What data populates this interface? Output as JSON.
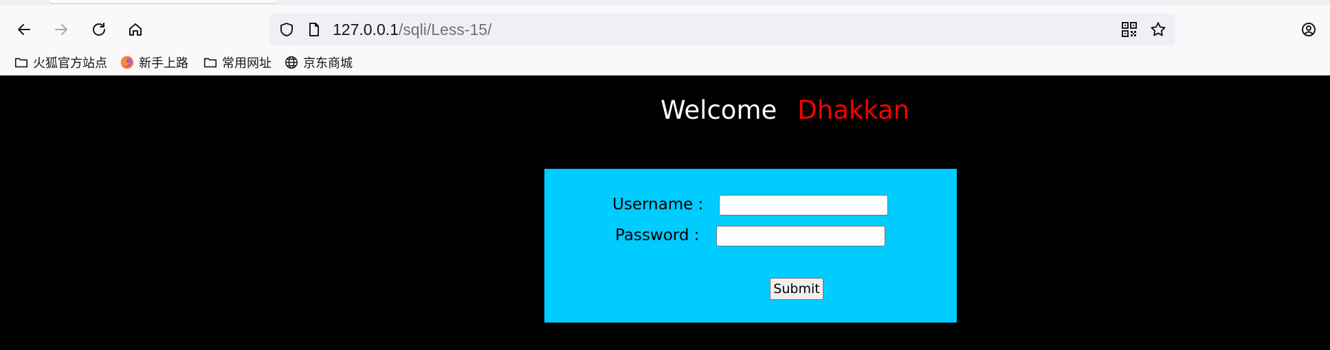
{
  "browser": {
    "url": {
      "host": "127.0.0.1",
      "path": "/sqli/Less-15/"
    },
    "nav_icons": [
      "back-icon",
      "forward-icon",
      "reload-icon",
      "home-icon",
      "account-icon"
    ],
    "urlbar_icons": [
      "shield-icon",
      "page-icon",
      "qr-code-icon",
      "star-icon"
    ],
    "bookmarks": [
      {
        "label": "火狐官方站点",
        "icon": "folder-icon"
      },
      {
        "label": "新手上路",
        "icon": "firefox-icon"
      },
      {
        "label": "常用网址",
        "icon": "folder-icon"
      },
      {
        "label": "京东商城",
        "icon": "globe-icon"
      }
    ]
  },
  "page": {
    "background": "#000000",
    "welcome": {
      "word": "Welcome",
      "name": "Dhakkan",
      "word_color": "#ffffff",
      "name_color": "#ff0000"
    },
    "form": {
      "panel_color": "#00ccff",
      "username_label": "Username :",
      "username_value": "",
      "password_label": "Password :",
      "password_value": "",
      "submit_label": "Submit"
    }
  }
}
